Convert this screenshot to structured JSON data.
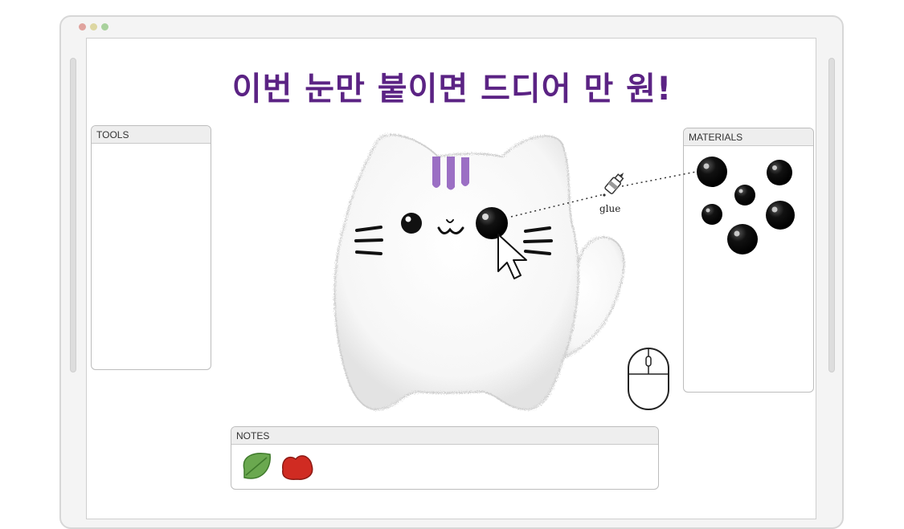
{
  "page": {
    "title": "이번 눈만 붙이면 드디어 만 원!"
  },
  "panels": {
    "tools": {
      "label": "TOOLS"
    },
    "materials": {
      "label": "MATERIALS"
    },
    "notes": {
      "label": "NOTES"
    }
  },
  "canvas": {
    "glue_label": "glue"
  },
  "colors": {
    "title": "#5b2384",
    "stripe": "#9b6fc4",
    "leaf": "#6aa84f",
    "blob": "#d02b22"
  }
}
